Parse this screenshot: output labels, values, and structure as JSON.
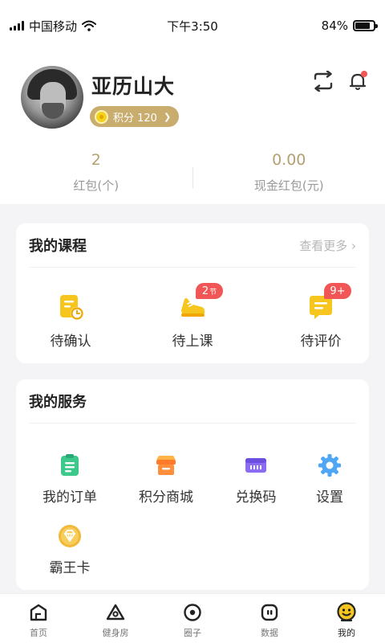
{
  "status_bar": {
    "carrier": "中国移动",
    "time": "下午3:50",
    "battery": "84%",
    "battery_level": 0.84
  },
  "profile": {
    "name": "亚历山大",
    "points_label": "积分 120",
    "stats": [
      {
        "value": "2",
        "label": "红包(个)"
      },
      {
        "value": "0.00",
        "label": "现金红包(元)"
      }
    ]
  },
  "courses": {
    "title": "我的课程",
    "more": "查看更多",
    "items": [
      {
        "label": "待确认",
        "icon": "clipboard-clock-icon",
        "badge": ""
      },
      {
        "label": "待上课",
        "icon": "sneaker-icon",
        "badge": "2",
        "badge_unit": "节"
      },
      {
        "label": "待评价",
        "icon": "comment-icon",
        "badge": "9+"
      }
    ]
  },
  "services": {
    "title": "我的服务",
    "items": [
      {
        "label": "我的订单",
        "icon": "order-list-icon"
      },
      {
        "label": "积分商城",
        "icon": "shop-icon"
      },
      {
        "label": "兑换码",
        "icon": "ticket-icon"
      },
      {
        "label": "设置",
        "icon": "gear-icon"
      },
      {
        "label": "霸王卡",
        "icon": "diamond-card-icon"
      }
    ]
  },
  "tabbar": {
    "items": [
      {
        "label": "首页",
        "icon": "home-icon"
      },
      {
        "label": "健身房",
        "icon": "gym-icon"
      },
      {
        "label": "圈子",
        "icon": "circle-icon"
      },
      {
        "label": "数据",
        "icon": "data-icon"
      },
      {
        "label": "我的",
        "icon": "profile-icon",
        "active": true
      }
    ]
  },
  "colors": {
    "accent_gold": "#c8ad6f",
    "badge_red": "#f15555",
    "stat_value": "#b4a070"
  }
}
